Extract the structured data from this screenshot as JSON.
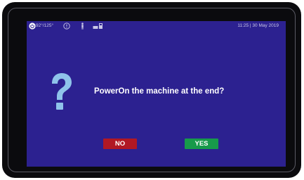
{
  "status_bar": {
    "temperature": "92°/125°",
    "datetime": "11:25 | 30 May 2019",
    "icons": [
      "power-icon",
      "alert-icon",
      "person-icon",
      "printer-icon"
    ]
  },
  "dialog": {
    "icon": "help-question-icon",
    "message": "PowerOn the machine at the end?",
    "no_label": "NO",
    "yes_label": "YES"
  },
  "colors": {
    "screen_background": "#2c2190",
    "no_button": "#b11824",
    "yes_button": "#179a4a",
    "help_icon": "#8fc3ea"
  }
}
